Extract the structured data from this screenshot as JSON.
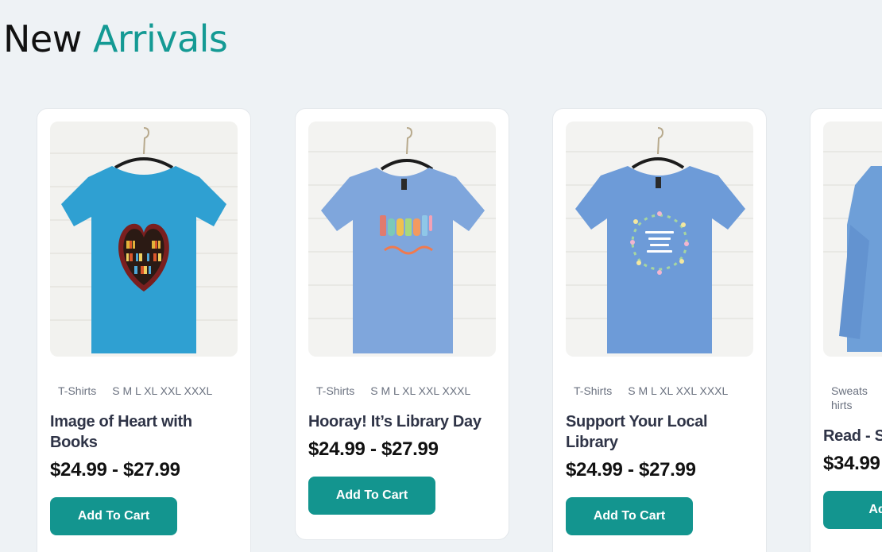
{
  "section": {
    "title_part1": "New",
    "title_part2": "Arrivals"
  },
  "colors": {
    "accent": "#149a94",
    "button": "#13958f",
    "background": "#eef2f5"
  },
  "products": [
    {
      "category": "T-Shirts",
      "sizes": "S M L XL XXL XXXL",
      "name": "Image of Heart with Books",
      "price": "$24.99 - $27.99",
      "button_label": "Add To Cart",
      "shirt_color": "#2fa0d2",
      "graphic": "heart-bookshelf"
    },
    {
      "category": "T-Shirts",
      "sizes": "S M L XL XXL XXXL",
      "name": "Hooray! It’s Library Day",
      "price": "$24.99 - $27.99",
      "button_label": "Add To Cart",
      "shirt_color": "#7fa6dc",
      "graphic": "hooray-text"
    },
    {
      "category": "T-Shirts",
      "sizes": "S M L XL XXL XXXL",
      "name": "Support Your Local Library",
      "price": "$24.99 - $27.99",
      "button_label": "Add To Cart",
      "shirt_color": "#6d9bd8",
      "graphic": "floral-wreath"
    },
    {
      "category": "Sweatshirts",
      "sizes": "",
      "name": "Read - S",
      "price": "$34.99",
      "button_label": "Add T",
      "shirt_color": "#6e9fd8",
      "graphic": "sweatshirt"
    }
  ]
}
